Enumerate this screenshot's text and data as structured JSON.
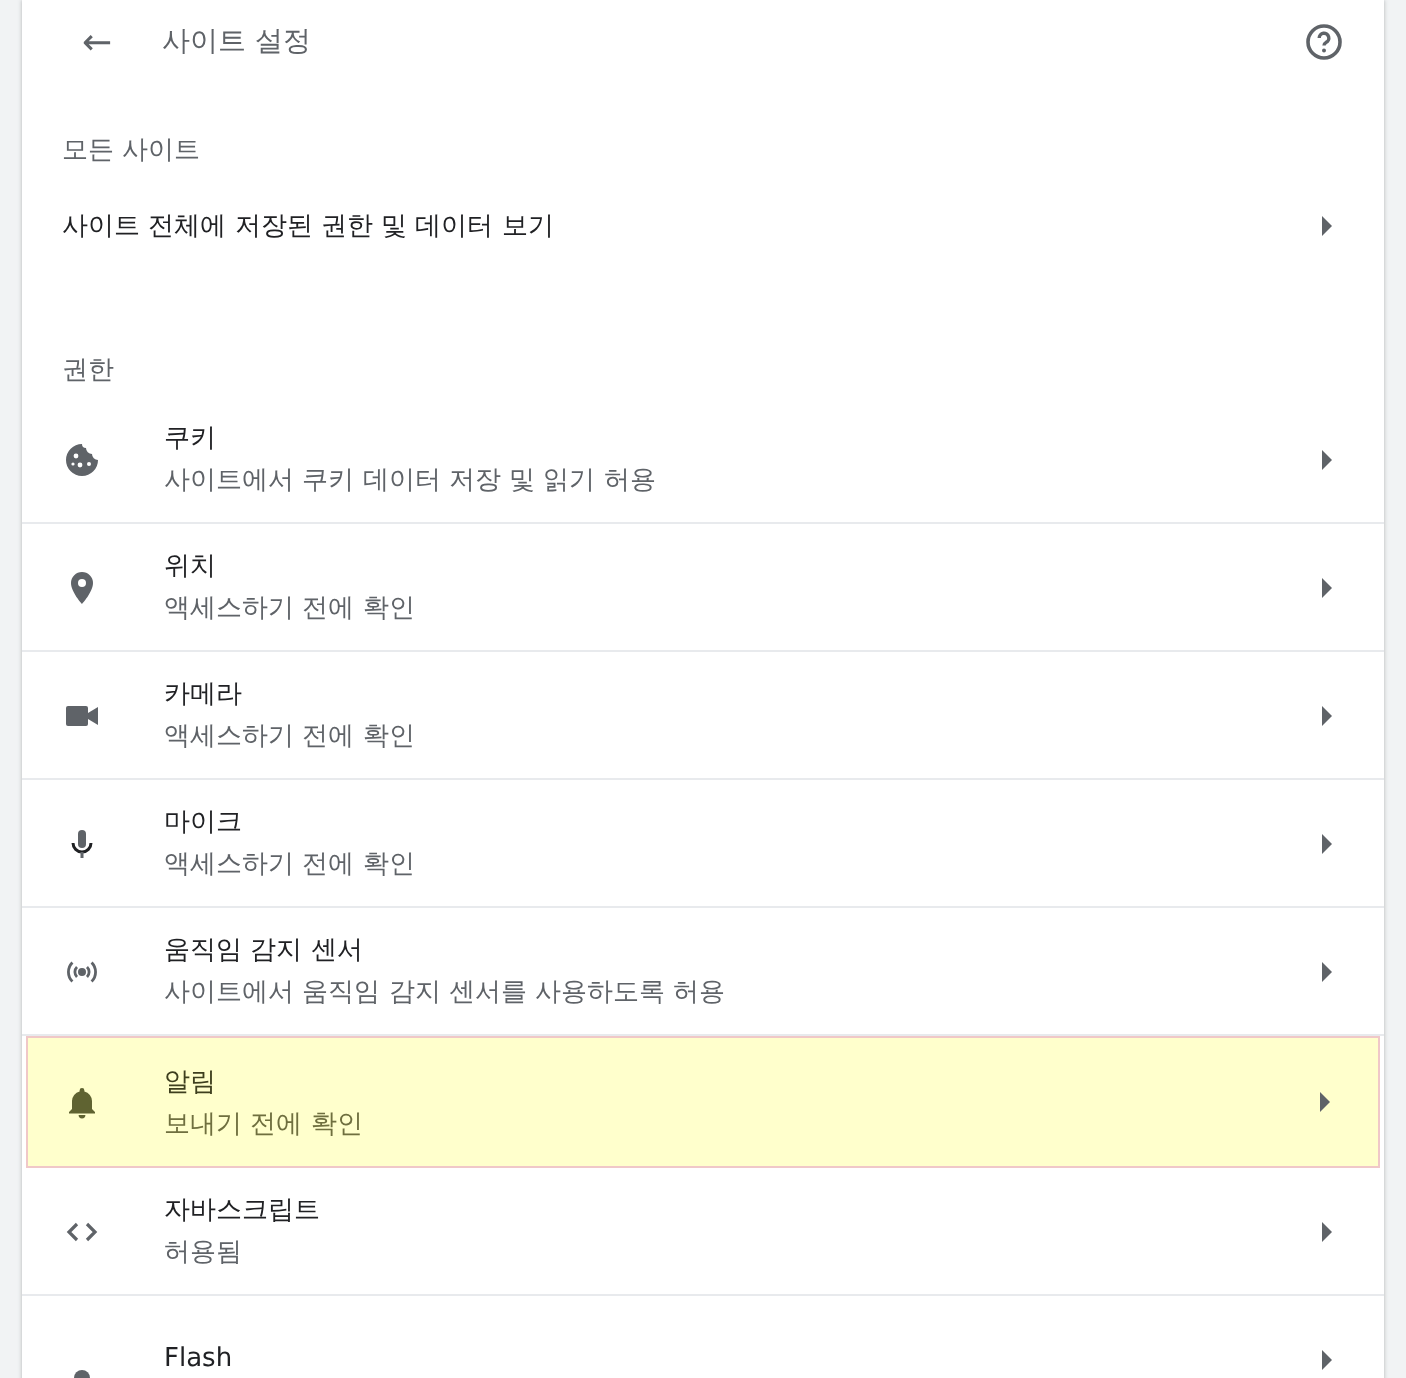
{
  "header": {
    "back": "←",
    "title": "사이트 설정"
  },
  "all_sites": {
    "heading": "모든 사이트",
    "link": "사이트 전체에 저장된 권한 및 데이터 보기"
  },
  "permissions": {
    "heading": "권한",
    "rows": [
      {
        "title": "쿠키",
        "subtitle": "사이트에서 쿠키 데이터 저장 및 읽기 허용",
        "highlighted": false
      },
      {
        "title": "위치",
        "subtitle": "액세스하기 전에 확인",
        "highlighted": false
      },
      {
        "title": "카메라",
        "subtitle": "액세스하기 전에 확인",
        "highlighted": false
      },
      {
        "title": "마이크",
        "subtitle": "액세스하기 전에 확인",
        "highlighted": false
      },
      {
        "title": "움직임 감지 센서",
        "subtitle": "사이트에서 움직임 감지 센서를 사용하도록 허용",
        "highlighted": false
      },
      {
        "title": "알림",
        "subtitle": "보내기 전에 확인",
        "highlighted": true
      },
      {
        "title": "자바스크립트",
        "subtitle": "허용됨",
        "highlighted": false
      },
      {
        "title": "Flash",
        "highlighted": false
      }
    ]
  }
}
